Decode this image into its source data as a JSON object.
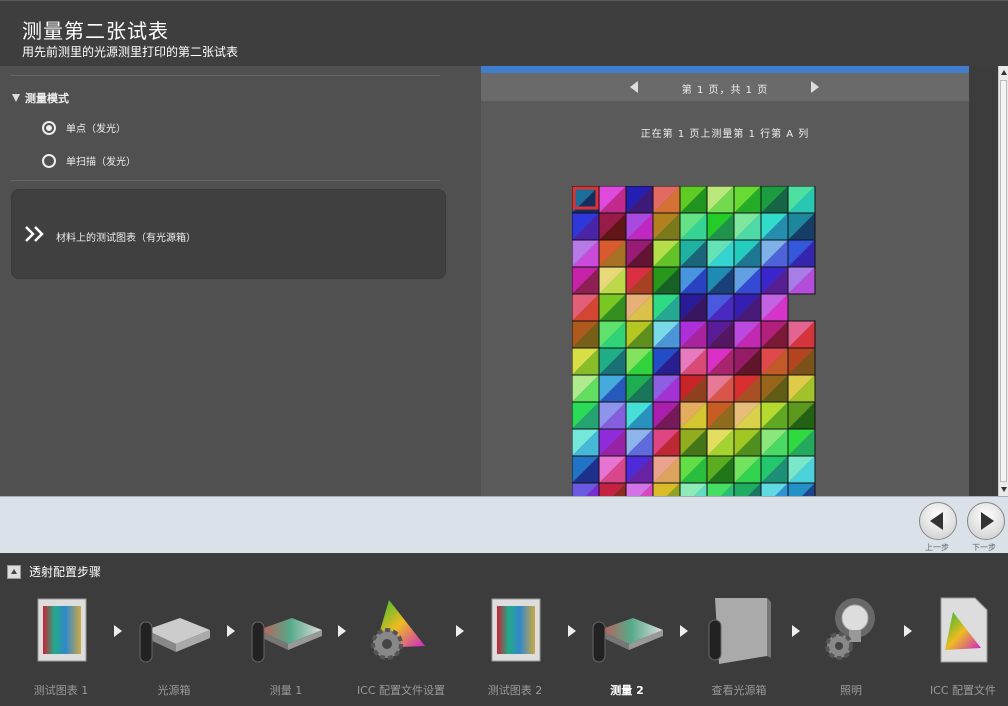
{
  "header": {
    "title": "测量第二张试表",
    "subtitle": "用先前测里的光源测里打印的第二张试表"
  },
  "mode": {
    "heading": "测量模式",
    "options": [
      "单点（发光）",
      "单扫描（发光）"
    ],
    "selected": "单点（发光）"
  },
  "chart_option": {
    "label": "材料上的测试图表（有光源箱）"
  },
  "preview": {
    "pager": "第 1 页，共 1 页",
    "status": "正在第 1 页上测量第 1 行第 A 列"
  },
  "nav": {
    "back_label": "上一步",
    "next_label": "下一步"
  },
  "steps_panel": {
    "title": "透射配置步骤",
    "steps": [
      {
        "label": "测试图表 1",
        "icon": "test-chart-icon"
      },
      {
        "label": "光源箱",
        "icon": "lightbox-icon"
      },
      {
        "label": "测量 1",
        "icon": "measure-icon"
      },
      {
        "label": "ICC 配置文件设置",
        "icon": "icc-settings-icon"
      },
      {
        "label": "测试图表 2",
        "icon": "test-chart-icon"
      },
      {
        "label": "测量 2",
        "icon": "measure-icon"
      },
      {
        "label": "查看光源箱",
        "icon": "view-lightbox-icon"
      },
      {
        "label": "照明",
        "icon": "lighting-icon"
      },
      {
        "label": "ICC 配置文件",
        "icon": "icc-profile-icon"
      }
    ],
    "active": "测量 2"
  },
  "colors": {
    "accent": "#3e7ecb",
    "panel": "#505050",
    "preview": "#5a5a5a"
  }
}
